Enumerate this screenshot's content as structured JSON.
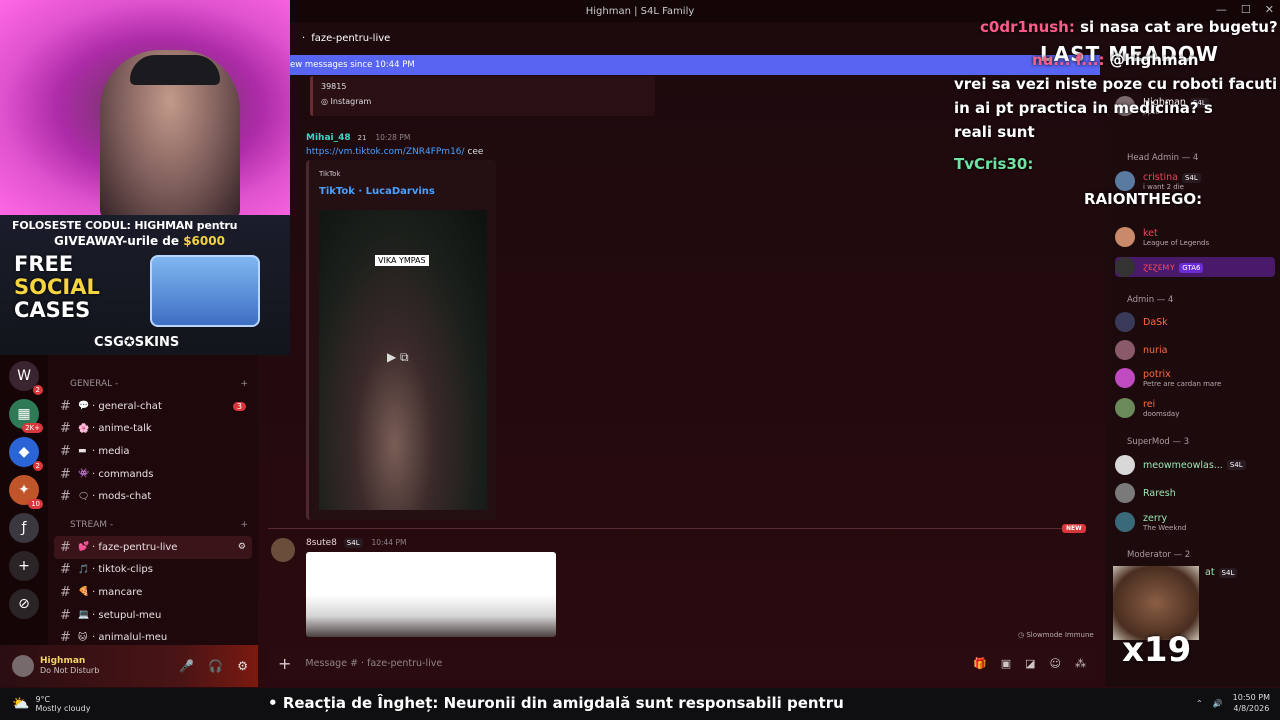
{
  "window": {
    "title": "Highman | S4L Family"
  },
  "overlay": {
    "promo_line1": "FOLOSESTE CODUL: HIGHMAN pentru",
    "promo_line2_a": "GIVEAWAY-urile de ",
    "promo_line2_b": "$6000",
    "free1": "FREE",
    "free2": "SOCIAL",
    "free3": "CASES",
    "brand": "CSG✪SKINS",
    "multiplier": "x19"
  },
  "channel_header": {
    "name": "faze-pentru-live"
  },
  "new_messages_bar": "ew messages since 10:44 PM",
  "embed_instagram": {
    "number": "39815",
    "provider": "Instagram"
  },
  "message1": {
    "author": "Mihai_48",
    "badge": "21",
    "time": "10:28 PM",
    "link": "https://vm.tiktok.com/ZNR4FPm16/",
    "text": "cee",
    "embed_provider": "TikTok",
    "embed_title": "TikTok · LucaDarvins",
    "video_caption": "VIKA YMPAS"
  },
  "new_tag": "NEW",
  "message2": {
    "author": "8sute8",
    "tag": "S4L",
    "time": "10:44 PM"
  },
  "slowmode": "Slowmode Immune",
  "composer": {
    "placeholder": "Message #   · faze-pentru-live"
  },
  "server_badges": [
    "2",
    "2K+",
    "2",
    "10"
  ],
  "categories": [
    {
      "name": "GENERAL -",
      "channels": [
        {
          "label": "· general-chat",
          "emoji": "💬",
          "count": "3"
        },
        {
          "label": "· anime-talk",
          "emoji": "🌸"
        },
        {
          "label": "· media",
          "emoji": "▬"
        },
        {
          "label": "· commands",
          "emoji": "👾"
        },
        {
          "label": "· mods-chat",
          "emoji": "🗨"
        }
      ]
    },
    {
      "name": "STREAM -",
      "channels": [
        {
          "label": "· faze-pentru-live",
          "emoji": "💕",
          "active": true
        },
        {
          "label": "· tiktok-clips",
          "emoji": "🎵"
        },
        {
          "label": "· mancare",
          "emoji": "🍕"
        },
        {
          "label": "· setupul-meu",
          "emoji": "💻"
        },
        {
          "label": "· animalul-meu",
          "emoji": "🐱"
        }
      ]
    }
  ],
  "user": {
    "name": "Highman",
    "status": "Do Not Disturb"
  },
  "members": {
    "top": {
      "name": "Highman",
      "tag": "S4L",
      "sub": "ppsc"
    },
    "groups": [
      {
        "title": "Head Admin — 4",
        "members": [
          {
            "name": "cristina",
            "tag": "S4L",
            "sub": "i want 2 die",
            "color": "#e8465a"
          },
          {
            "name": "ket",
            "sub": "League of Legends",
            "color": "#e8465a"
          },
          {
            "name": "ɀᴇɀᴇᴍʏ",
            "tag": "GTA6",
            "color": "#e8465a"
          }
        ]
      },
      {
        "title": "Admin — 4",
        "members": [
          {
            "name": "DaSk",
            "color": "#ff6a3d"
          },
          {
            "name": "nuria",
            "color": "#ff6a3d"
          },
          {
            "name": "potrix",
            "sub": "Petre are cardan mare",
            "color": "#ff6a3d"
          },
          {
            "name": "rei",
            "sub": "doomsday",
            "color": "#ff6a3d"
          }
        ]
      },
      {
        "title": "SuperMod — 3",
        "members": [
          {
            "name": "meowmeowlas...",
            "tag": "S4L",
            "color": "#9ae6b4"
          },
          {
            "name": "Raresh",
            "color": "#9ae6b4"
          },
          {
            "name": "zerry",
            "sub": "The Weeknd",
            "color": "#9ae6b4"
          }
        ]
      },
      {
        "title": "Moderator — 2",
        "members": [
          {
            "name": "at",
            "tag": "S4L",
            "color": "#9ae6b4"
          }
        ]
      }
    ]
  },
  "stream_chat": [
    {
      "user": "c0dr1nush:",
      "text": "si nasa cat are bugetu?",
      "color": "#ff5b8a"
    },
    {
      "user": "nu... f...:",
      "text": "@highman",
      "color": "#ff5b8a"
    },
    {
      "text": "vrei sa vezi niste poze cu roboti facuti"
    },
    {
      "text": "in ai pt practica in medicina? s"
    },
    {
      "text": "reali sunt"
    },
    {
      "user": "TvCris30:",
      "text": "",
      "color": "#6fe3a1"
    },
    {
      "user": "RAIONTHEGO:",
      "text": "",
      "color": "#ffffff"
    }
  ],
  "last_meadow": "LAST MEADOW",
  "taskbar": {
    "temp": "9°C",
    "weather": "Mostly cloudy",
    "ticker_bold": "Reacția de Îngheț:",
    "ticker_rest": " Neuronii din amigdală sunt responsabili pentru",
    "time": "10:50 PM",
    "date": "4/8/2026"
  },
  "colors": {
    "accent": "#5865f2",
    "dnd": "#da373c",
    "link": "#4aa0ff"
  }
}
